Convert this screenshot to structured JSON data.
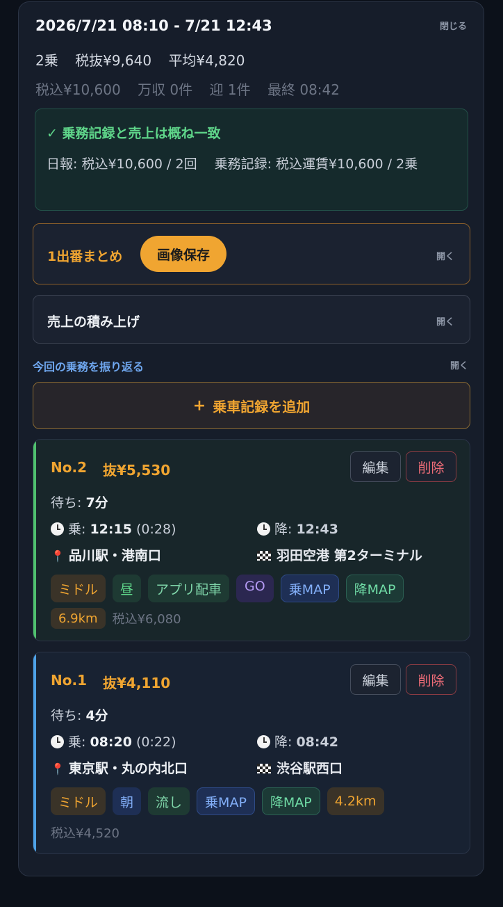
{
  "header": {
    "title": "2026/7/21 08:10 - 7/21 12:43",
    "close_label": "閉じる",
    "summary1": [
      "2乗",
      "税抜¥9,640",
      "平均¥4,820"
    ],
    "summary2": [
      "税込¥10,600",
      "万収 0件",
      "迎 1件",
      "最終 08:42"
    ]
  },
  "match": {
    "title": "✓ 乗務記録と売上は概ね一致",
    "body": "日報: 税込¥10,600 / 2回　 乗務記録: 税込運賃¥10,600 / 2乗"
  },
  "summary_panel": {
    "label": "1出番まとめ",
    "save_label": "画像保存",
    "open_label": "開く"
  },
  "sales_panel": {
    "label": "売上の積み上げ",
    "open_label": "開く"
  },
  "review": {
    "label": "今回の乗務を振り返る",
    "open_label": "開く"
  },
  "add_button": {
    "icon": "plus-icon",
    "label": "乗車記録を追加"
  },
  "rides": [
    {
      "no": "No.2",
      "fare": "抜¥5,530",
      "edit": "編集",
      "delete": "削除",
      "accent": "#4fc16e",
      "wait_label": "待ち:",
      "wait": "7分",
      "board_label": "乗:",
      "board_time": "12:15",
      "board_dur": "(0:28)",
      "alight_label": "降:",
      "alight_time": "12:43",
      "from": "品川駅・港南口",
      "to": "羽田空港 第2ターミナル",
      "tags": [
        "ミドル",
        "昼",
        "アプリ配車",
        "GO",
        "乗MAP",
        "降MAP"
      ],
      "km": "6.9km",
      "taxin": "税込¥6,080"
    },
    {
      "no": "No.1",
      "fare": "抜¥4,110",
      "edit": "編集",
      "delete": "削除",
      "accent": "#4ea3e8",
      "wait_label": "待ち:",
      "wait": "4分",
      "board_label": "乗:",
      "board_time": "08:20",
      "board_dur": "(0:22)",
      "alight_label": "降:",
      "alight_time": "08:42",
      "from": "東京駅・丸の内北口",
      "to": "渋谷駅西口",
      "tags": [
        "ミドル",
        "朝",
        "流し",
        "乗MAP",
        "降MAP"
      ],
      "km": "4.2km",
      "taxin": "税込¥4,520"
    }
  ]
}
